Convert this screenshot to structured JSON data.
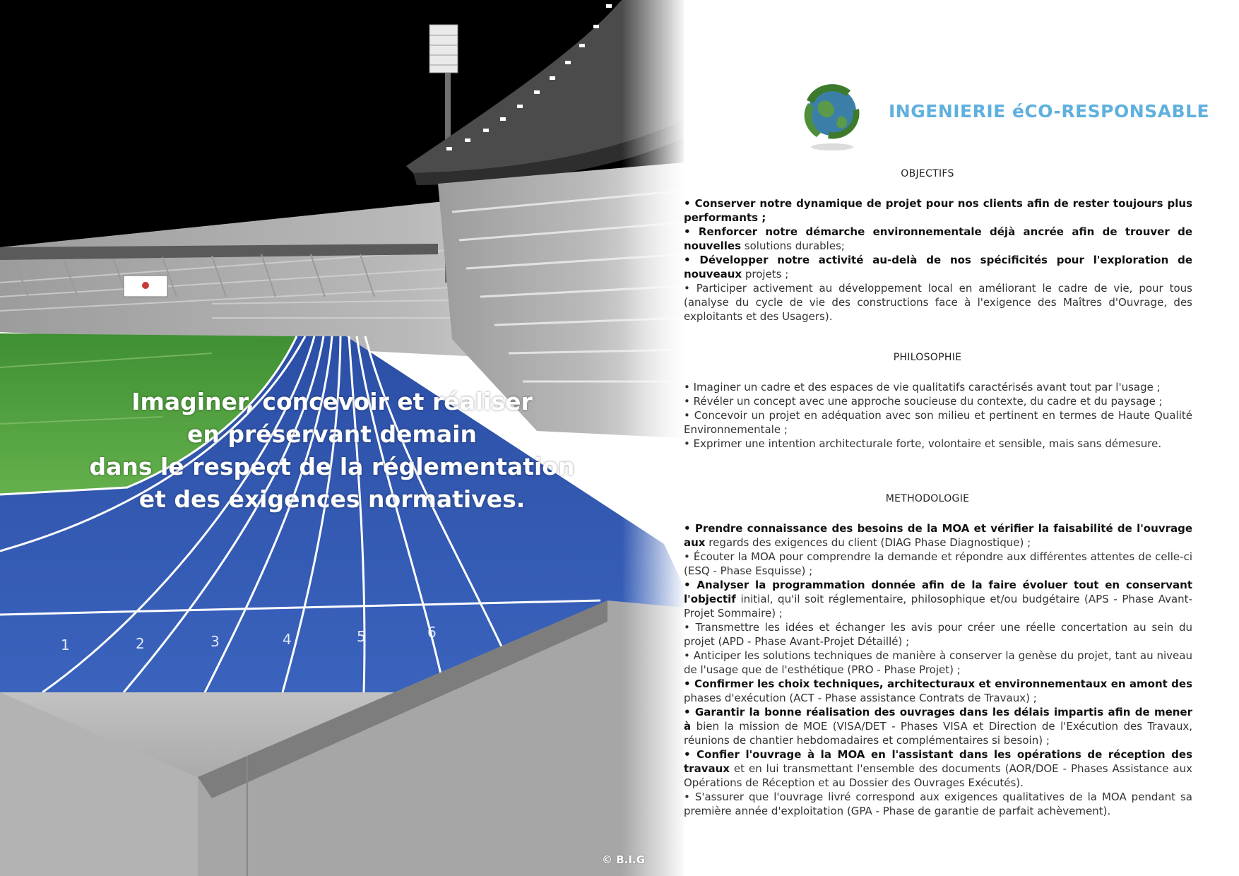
{
  "photo": {
    "lane_numbers": [
      "1",
      "2",
      "3",
      "4",
      "5",
      "6"
    ],
    "slogan_lines": [
      "Imaginer, concevoir et réaliser",
      "en préservant demain",
      "dans le respect de la réglementation",
      "et des exigences normatives."
    ],
    "copyright": "© B.I.G"
  },
  "header": {
    "title": "INGENIERIE éCO-RESPONSABLE",
    "logo_icon": "recycling-globe-icon"
  },
  "sections": [
    {
      "heading": "OBJECTIFS",
      "items": [
        {
          "lead": "• Conserver notre dynamique de projet pour nos clients afin de rester toujours plus performants ;",
          "rest": ""
        },
        {
          "lead": "• Renforcer notre démarche environnementale déjà ancrée afin de trouver de nouvelles",
          "rest": "solutions durables;"
        },
        {
          "lead": "• Développer notre activité au-delà de nos spécificités pour l'exploration de nouveaux",
          "rest": "projets ;"
        },
        {
          "lead": "",
          "rest": "• Participer activement au développement local en améliorant le cadre de vie, pour tous (analyse du cycle de vie des constructions face à l'exigence des Maîtres d'Ouvrage, des exploitants et des Usagers)."
        }
      ]
    },
    {
      "heading": "PHILOSOPHIE",
      "items": [
        {
          "lead": "",
          "rest": "• Imaginer un cadre et des espaces de vie qualitatifs caractérisés avant tout par l'usage ;"
        },
        {
          "lead": "",
          "rest": "• Révéler un concept avec une approche soucieuse du contexte, du cadre et du paysage ;"
        },
        {
          "lead": "",
          "rest": "• Concevoir un projet en adéquation avec son milieu et pertinent en termes de Haute Qualité Environnementale ;"
        },
        {
          "lead": "",
          "rest": "• Exprimer une intention architecturale forte, volontaire et sensible, mais sans démesure."
        }
      ]
    },
    {
      "heading": "METHODOLOGIE",
      "items": [
        {
          "lead": "• Prendre connaissance des besoins de la MOA et vérifier la faisabilité de l'ouvrage aux",
          "rest": "regards des exigences du client (DIAG Phase Diagnostique) ;"
        },
        {
          "lead": "",
          "rest": "• Écouter la MOA pour comprendre la demande et répondre aux différentes attentes de celle-ci (ESQ - Phase Esquisse) ;"
        },
        {
          "lead": "• Analyser la programmation donnée afin de la faire évoluer tout en conservant l'objectif",
          "rest": "initial, qu'il soit réglementaire, philosophique et/ou budgétaire (APS - Phase Avant-Projet Sommaire) ;"
        },
        {
          "lead": "",
          "rest": "• Transmettre les idées et échanger les avis pour créer une réelle concertation au sein du projet (APD - Phase Avant-Projet Détaillé) ;"
        },
        {
          "lead": "",
          "rest": "• Anticiper les solutions techniques de manière à conserver la genèse du projet, tant au niveau de l'usage que de l'esthétique (PRO - Phase Projet) ;"
        },
        {
          "lead": "• Confirmer les choix techniques, architecturaux et environnementaux en amont des",
          "rest": "phases d'exécution (ACT - Phase assistance Contrats de Travaux) ;"
        },
        {
          "lead": "• Garantir la bonne réalisation des ouvrages dans les délais impartis afin de mener à",
          "rest": "bien la mission de MOE (VISA/DET - Phases VISA et Direction de l'Exécution des Travaux, réunions de chantier hebdomadaires et complémentaires si besoin) ;"
        },
        {
          "lead": "• Confier l'ouvrage à la MOA en l'assistant dans les opérations de réception des travaux",
          "rest": "et en lui transmettant l'ensemble des documents (AOR/DOE - Phases Assistance aux Opérations de Réception et au Dossier des Ouvrages Exécutés)."
        },
        {
          "lead": "",
          "rest": "• S'assurer que l'ouvrage livré correspond aux exigences qualitatives de la MOA pendant sa première année d'exploitation (GPA - Phase de garantie de parfait achèvement)."
        }
      ]
    }
  ],
  "colors": {
    "title": "#5fb0de",
    "track": "#2f56b0",
    "grass": "#4d9a3a",
    "sky": "#000000"
  }
}
